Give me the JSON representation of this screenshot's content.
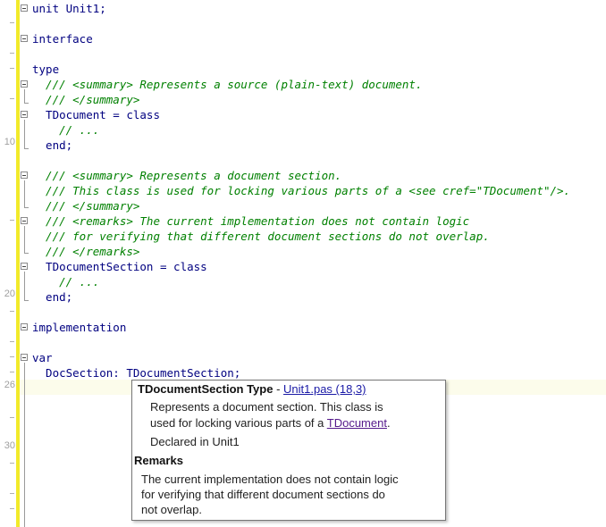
{
  "editor": {
    "line_numbers": [
      "10",
      "20",
      "26",
      "30"
    ],
    "lines": [
      {
        "segments": [
          {
            "t": "unit Unit1;",
            "c": "kw"
          }
        ]
      },
      {
        "segments": []
      },
      {
        "segments": [
          {
            "t": "interface",
            "c": "kw"
          }
        ]
      },
      {
        "segments": []
      },
      {
        "segments": [
          {
            "t": "type",
            "c": "kw"
          }
        ]
      },
      {
        "segments": [
          {
            "t": "  /// <summary> Represents a source (plain-text) document.",
            "c": "cmt"
          }
        ]
      },
      {
        "segments": [
          {
            "t": "  /// </summary>",
            "c": "cmt"
          }
        ]
      },
      {
        "segments": [
          {
            "t": "  TDocument = ",
            "c": "kw"
          },
          {
            "t": "class",
            "c": "kw"
          }
        ]
      },
      {
        "segments": [
          {
            "t": "    // ...",
            "c": "cmt"
          }
        ]
      },
      {
        "segments": [
          {
            "t": "  end;",
            "c": "kw"
          }
        ]
      },
      {
        "segments": []
      },
      {
        "segments": [
          {
            "t": "  /// <summary> Represents a document section.",
            "c": "cmt"
          }
        ]
      },
      {
        "segments": [
          {
            "t": "  /// This class is used for locking various parts of a <see cref=\"TDocument\"/>.",
            "c": "cmt"
          }
        ]
      },
      {
        "segments": [
          {
            "t": "  /// </summary>",
            "c": "cmt"
          }
        ]
      },
      {
        "segments": [
          {
            "t": "  /// <remarks> The current implementation does not contain logic",
            "c": "cmt"
          }
        ]
      },
      {
        "segments": [
          {
            "t": "  /// for verifying that different document sections do not overlap.",
            "c": "cmt"
          }
        ]
      },
      {
        "segments": [
          {
            "t": "  /// </remarks>",
            "c": "cmt"
          }
        ]
      },
      {
        "segments": [
          {
            "t": "  TDocumentSection = ",
            "c": "kw"
          },
          {
            "t": "class",
            "c": "kw"
          }
        ]
      },
      {
        "segments": [
          {
            "t": "    // ...",
            "c": "cmt"
          }
        ]
      },
      {
        "segments": [
          {
            "t": "  end;",
            "c": "kw"
          }
        ]
      },
      {
        "segments": []
      },
      {
        "segments": [
          {
            "t": "implementation",
            "c": "kw"
          }
        ]
      },
      {
        "segments": []
      },
      {
        "segments": [
          {
            "t": "var",
            "c": "kw"
          }
        ]
      },
      {
        "segments": [
          {
            "t": "  DocSection: TDocumentSection;",
            "c": "kw"
          }
        ]
      }
    ]
  },
  "tooltip": {
    "title": "TDocumentSection Type",
    "separator": " - ",
    "location_link": "Unit1.pas (18,3)",
    "summary_line1": "Represents a document section. This class is",
    "summary_line2_prefix": "used for locking various parts of a ",
    "summary_ref": "TDocument",
    "summary_line2_suffix": ".",
    "declared_in": "Declared in Unit1",
    "remarks_heading": "Remarks",
    "remarks_line1": "The current implementation does not contain logic",
    "remarks_line2": "for verifying that different document sections do",
    "remarks_line3": "not overlap."
  }
}
